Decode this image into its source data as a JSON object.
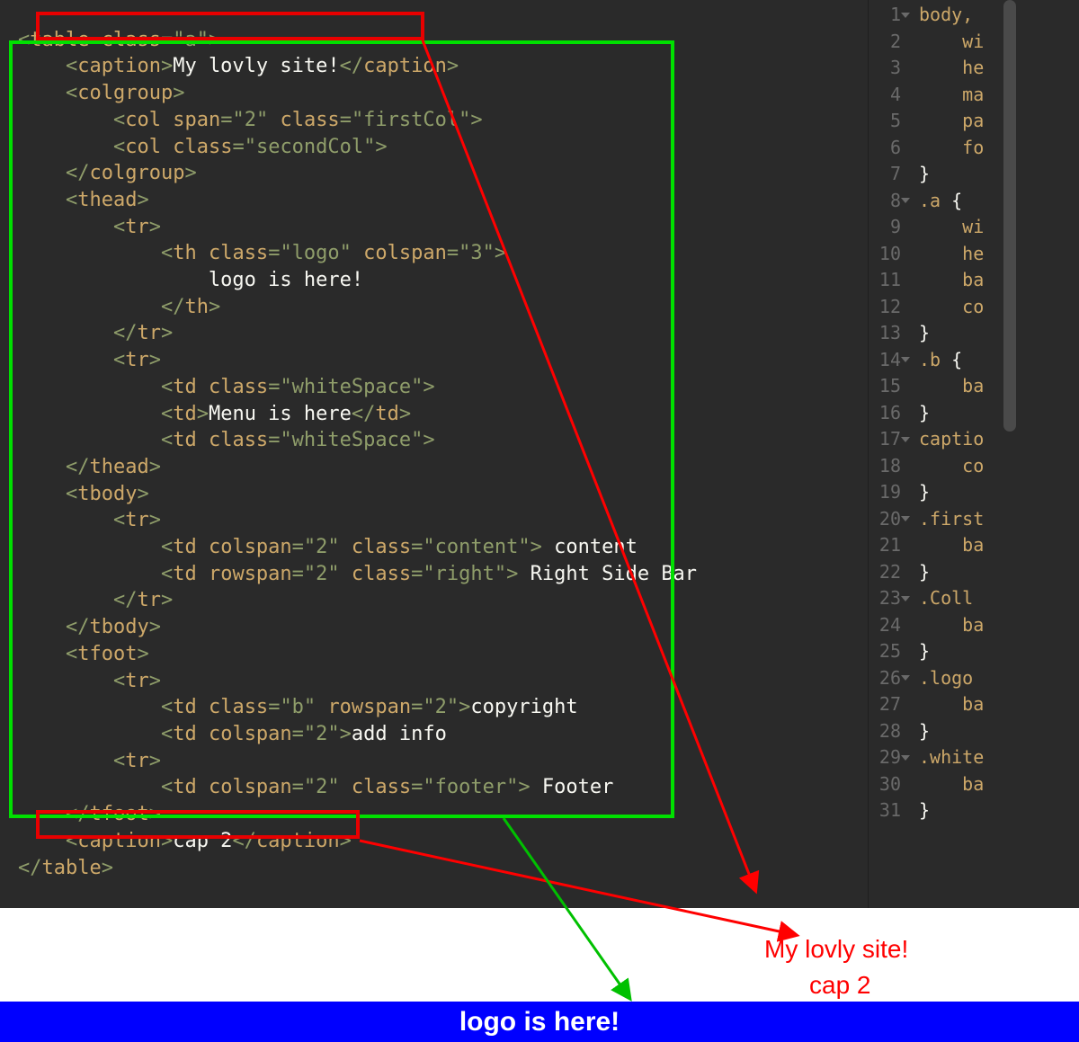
{
  "left_code": {
    "l0": "<table class=\"a\">",
    "caption1": {
      "open": "<caption>",
      "text": "My lovly site!",
      "close": "</caption>"
    },
    "colgroup_open": "<colgroup>",
    "col1": "<col span=\"2\" class=\"firstCol\">",
    "col2": "<col class=\"secondCol\">",
    "colgroup_close": "</colgroup>",
    "thead_open": "<thead>",
    "tr_open": "<tr>",
    "th_open": "<th class=\"logo\" colspan=\"3\">",
    "logo_text": "logo is here!",
    "th_close": "</th>",
    "tr_close": "</tr>",
    "tr_open2": "<tr>",
    "td_ws1": "<td class=\"whiteSpace\">",
    "td_menu": {
      "open": "<td>",
      "text": "Menu is here",
      "close": "</td>"
    },
    "td_ws2": "<td class=\"whiteSpace\">",
    "thead_close": "</thead>",
    "tbody_open": "<tbody>",
    "tr_open3": "<tr>",
    "td_content": {
      "open": "<td colspan=\"2\" class=\"content\">",
      "text": " content"
    },
    "td_right": {
      "open": "<td rowspan=\"2\" class=\"right\">",
      "text": " Right Side Bar"
    },
    "tr_close2": "</tr>",
    "tbody_close": "</tbody>",
    "tfoot_open": "<tfoot>",
    "tr_open4": "<tr>",
    "td_copy": {
      "open": "<td class=\"b\" rowspan=\"2\">",
      "text": "copyright"
    },
    "td_add": {
      "open": "<td colspan=\"2\">",
      "text": "add info"
    },
    "tr_open5": "<tr>",
    "td_foot": {
      "open": "<td colspan=\"2\" class=\"footer\">",
      "text": " Footer"
    },
    "tfoot_close": "</tfoot>",
    "caption2": {
      "open": "<caption>",
      "text": "cap 2",
      "close": "</caption>"
    },
    "table_close": "</table>"
  },
  "right_lines": {
    "nums": [
      "1",
      "2",
      "3",
      "4",
      "5",
      "6",
      "7",
      "8",
      "9",
      "10",
      "11",
      "12",
      "13",
      "14",
      "15",
      "16",
      "17",
      "18",
      "19",
      "20",
      "21",
      "22",
      "23",
      "24",
      "25",
      "26",
      "27",
      "28",
      "29",
      "30",
      "31"
    ],
    "text": [
      "body,",
      "    wi",
      "    he",
      "    ma",
      "    pa",
      "    fo",
      "}",
      ".a {",
      "    wi",
      "    he",
      "    ba",
      "    co",
      "}",
      ".b {",
      "    ba",
      "}",
      "captio",
      "    co",
      "}",
      ".first",
      "    ba",
      "}",
      ".Coll",
      "    ba",
      "}",
      ".logo",
      "    ba",
      "}",
      ".white",
      "    ba",
      "}"
    ],
    "folds": [
      0,
      7,
      13,
      16,
      19,
      22,
      25,
      28
    ]
  },
  "annotations": {
    "caption1": "My lovly site!",
    "caption2": "cap 2",
    "logo": "logo is here!"
  }
}
